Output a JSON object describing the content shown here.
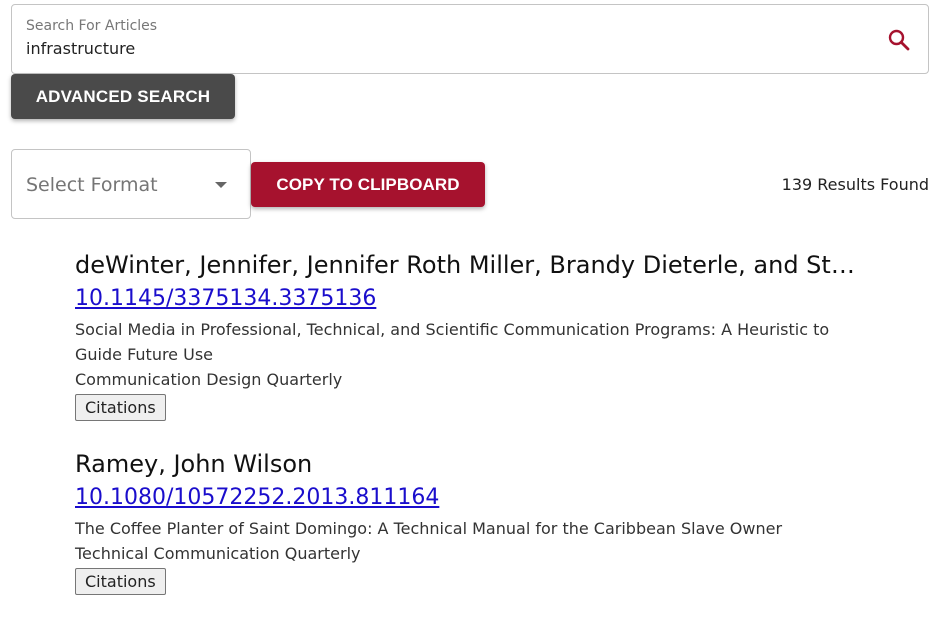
{
  "search": {
    "label": "Search For Articles",
    "value": "infrastructure"
  },
  "buttons": {
    "advanced_search": "ADVANCED SEARCH",
    "copy_to_clipboard": "COPY TO CLIPBOARD"
  },
  "format_select": {
    "placeholder": "Select Format"
  },
  "results_count": "139 Results Found",
  "results": [
    {
      "authors": "deWinter, Jennifer, Jennifer Roth Miller, Brandy Dieterle, and Stephanie Vie",
      "doi": "10.1145/3375134.3375136",
      "title": "Social Media in Professional, Technical, and Scientific Communication Programs: A Heuristic to Guide Future Use",
      "journal": "Communication Design Quarterly",
      "citations_label": "Citations"
    },
    {
      "authors": "Ramey, John Wilson",
      "doi": "10.1080/10572252.2013.811164",
      "title": "The Coffee Planter of Saint Domingo: A Technical Manual for the Caribbean Slave Owner",
      "journal": "Technical Communication Quarterly",
      "citations_label": "Citations"
    }
  ],
  "colors": {
    "brand_red": "#a6122e",
    "dark_button": "#4a4a4a",
    "link_blue": "#1a0dcc"
  }
}
